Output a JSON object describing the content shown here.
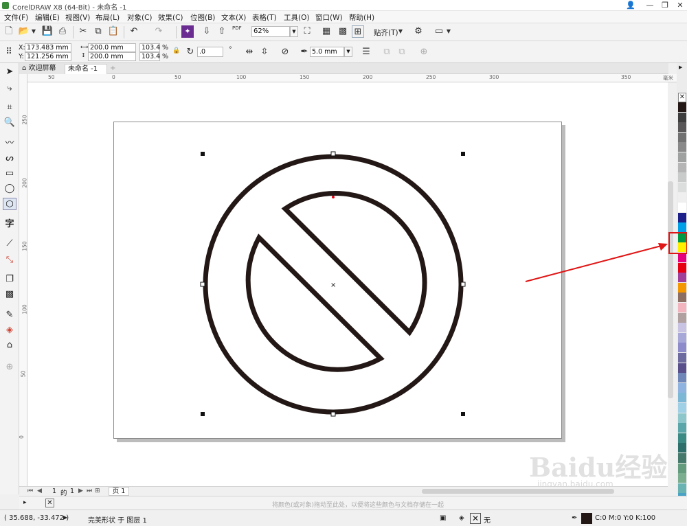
{
  "app": {
    "title": "CorelDRAW X8 (64-Bit) - 未命名 -1"
  },
  "window_controls": {
    "help": "👤",
    "minimize": "—",
    "restore": "❐",
    "close": "✕"
  },
  "menu": [
    "文件(F)",
    "编辑(E)",
    "视图(V)",
    "布局(L)",
    "对象(C)",
    "效果(C)",
    "位图(B)",
    "文本(X)",
    "表格(T)",
    "工具(O)",
    "窗口(W)",
    "帮助(H)"
  ],
  "toolbar": {
    "zoom": "62%",
    "snap_label": "贴齐(T)",
    "pdf_label": "PDF"
  },
  "properties": {
    "x": "173.483 mm",
    "y": "121.256 mm",
    "width": "200.0 mm",
    "height": "200.0 mm",
    "scale_w": "103.4",
    "scale_h": "103.4",
    "percent": "%",
    "rotation": ".0",
    "degree": "°",
    "outline_width": "5.0 mm",
    "x_label": "X:",
    "y_label": "Y:"
  },
  "tabs": {
    "welcome": "欢迎屏幕",
    "doc": "未命名 -1",
    "add": "+"
  },
  "rulers": {
    "h_ticks": [
      "50",
      "0",
      "50",
      "100",
      "150",
      "200",
      "250",
      "300",
      "350"
    ],
    "v_ticks": [
      "250",
      "200",
      "150",
      "100",
      "50",
      "0"
    ],
    "unit": "毫米"
  },
  "pagenav": {
    "current": "1",
    "of": "的",
    "total": "1",
    "tab": "页 1"
  },
  "docpalette_hint": "将颜色(或对象)拖动至此处，以便将这些颜色与文档存储在一起",
  "status": {
    "coords": "( 35.688, -33.472 )",
    "object": "完美形状 于 图层 1",
    "fill": "无",
    "outline": "C:0 M:0 Y:0 K:100"
  },
  "watermark": {
    "main": "Baidu经验",
    "sub": "jingyan.baidu.com"
  },
  "colors": {
    "accent_red": "#e01515",
    "stroke": "#231815",
    "palette": [
      "#231815",
      "#3e3e3e",
      "#595757",
      "#727171",
      "#898989",
      "#9fa0a0",
      "#b5b5b6",
      "#c9caca",
      "#dcdddd",
      "#efefef",
      "#ffffff",
      "#1d2088",
      "#00a0e9",
      "#009944",
      "#fff100",
      "#e4007f",
      "#e60012",
      "#a0409a",
      "#f39800",
      "#8c6e63",
      "#f2b5c0",
      "#b0a0a0",
      "#c9c3e3",
      "#a7a7d8",
      "#8d8bc9",
      "#6d6aa0",
      "#584f8b",
      "#6f86b8",
      "#8fb3e0",
      "#7cb7d6",
      "#9fd0e6",
      "#8ec7cb",
      "#5aa6a8",
      "#3b8a83",
      "#2d6f6a",
      "#44796b",
      "#629b7d",
      "#7aae8e",
      "#69b3b3",
      "#4aa3c4"
    ]
  }
}
